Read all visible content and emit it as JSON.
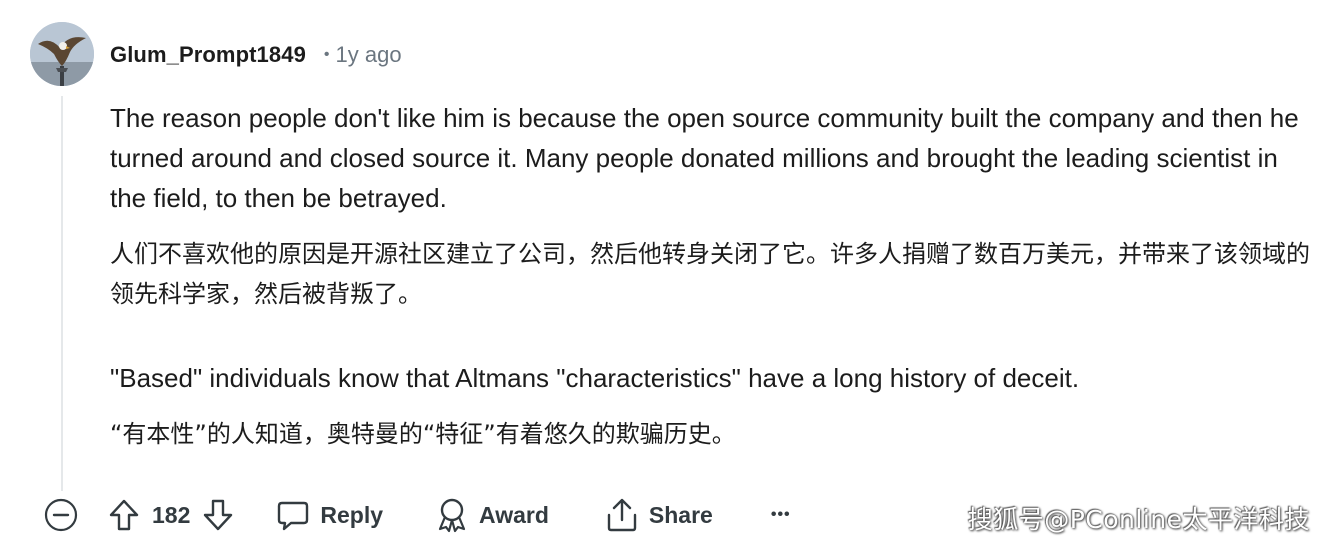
{
  "comment": {
    "username": "Glum_Prompt1849",
    "separator": "•",
    "timestamp": "1y ago",
    "paragraphs": [
      "The reason people don't like him is because the open source community built the company and then he turned around and closed source it. Many people donated millions and brought the leading scientist in the field, to then be betrayed.",
      "人们不喜欢他的原因是开源社区建立了公司，然后他转身关闭了它。许多人捐赠了数百万美元，并带来了该领域的领先科学家，然后被背叛了。",
      "\"Based\" individuals know that Altmans \"characteristics\" have a long history of deceit.",
      "“有本性”的人知道，奥特曼的“特征”有着悠久的欺骗历史。"
    ]
  },
  "actions": {
    "score": "182",
    "reply_label": "Reply",
    "award_label": "Award",
    "share_label": "Share",
    "more_label": "•••"
  },
  "watermark": "搜狐号@PConline太平洋科技",
  "icons": {
    "collapse": "minus-circle-icon",
    "upvote": "arrow-up-icon",
    "downvote": "arrow-down-icon",
    "reply": "speech-bubble-icon",
    "award": "award-ribbon-icon",
    "share": "share-upload-icon",
    "more": "more-dots-icon"
  }
}
